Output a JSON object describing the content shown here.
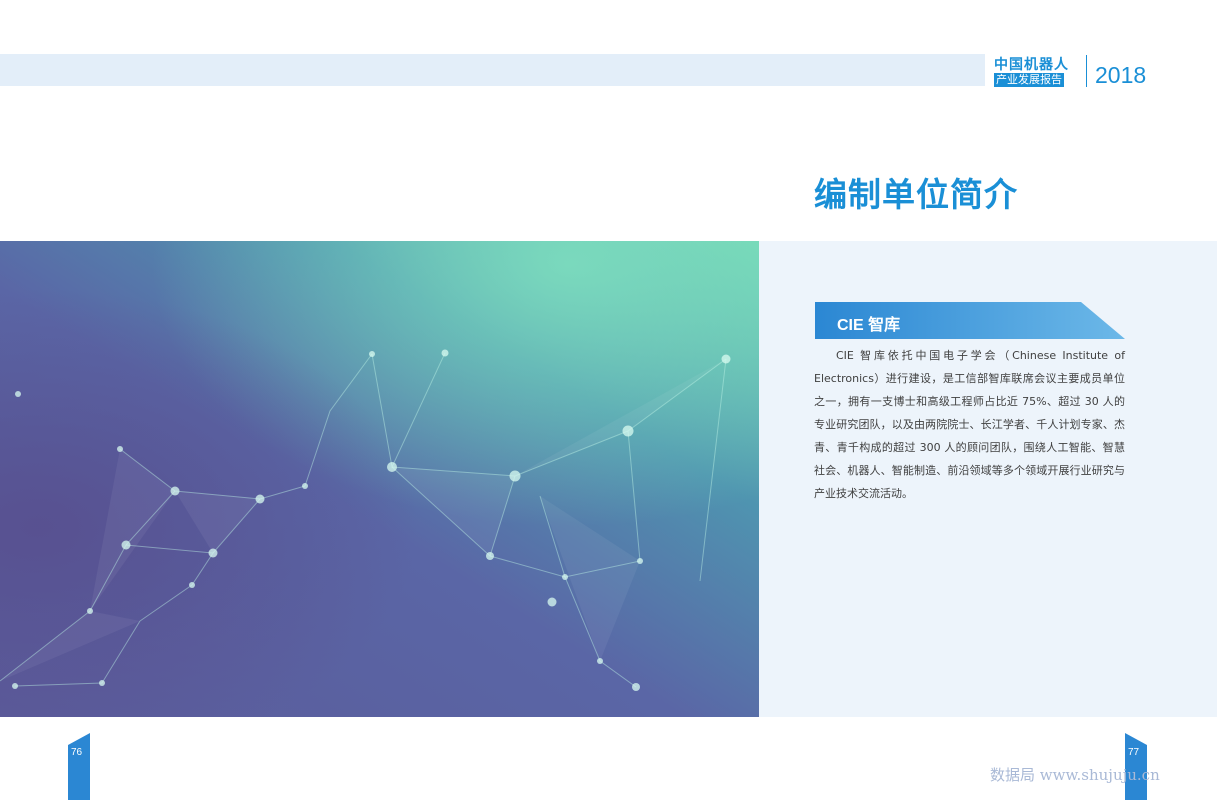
{
  "header": {
    "brand_line1": "中国机器人",
    "brand_line2": "产业发展报告",
    "year": "2018"
  },
  "page_title": "编制单位简介",
  "section": {
    "title": "CIE 智库",
    "body": "CIE 智库依托中国电子学会（Chinese Institute of Electronics）进行建设，是工信部智库联席会议主要成员单位之一，拥有一支博士和高级工程师占比近 75%、超过 30 人的专业研究团队，以及由两院院士、长江学者、千人计划专家、杰青、青千构成的超过 300 人的顾问团队，围绕人工智能、智慧社会、机器人、智能制造、前沿领域等多个领域开展行业研究与产业技术交流活动。"
  },
  "pages": {
    "left": "76",
    "right": "77"
  },
  "watermark": "数据局 www.shujuju.cn",
  "colors": {
    "accent": "#1a8fd6",
    "header_band": "#e3eef9",
    "panel_bg": "#edf4fb",
    "hero_purple": "#5a5b98",
    "hero_teal": "#6fd3b3",
    "watermark": "#a9b9d6"
  }
}
